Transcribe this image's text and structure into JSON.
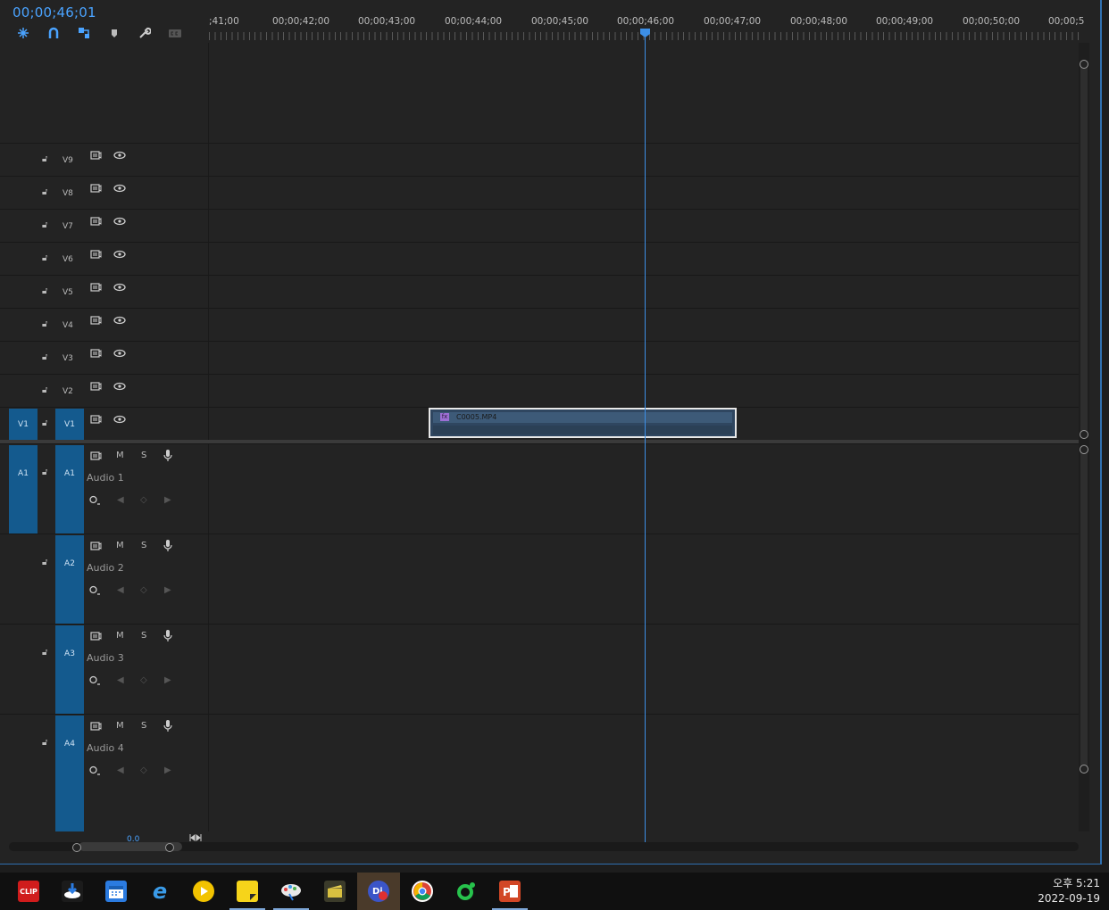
{
  "timeline": {
    "timecode": "00;00;46;01",
    "ruler_labels": [
      ";41;00",
      "00;00;42;00",
      "00;00;43;00",
      "00;00;44;00",
      "00;00;45;00",
      "00;00;46;00",
      "00;00;47;00",
      "00;00;48;00",
      "00;00;49;00",
      "00;00;50;00",
      "00;00;5"
    ],
    "video_tracks": [
      {
        "name": "V9"
      },
      {
        "name": "V8"
      },
      {
        "name": "V7"
      },
      {
        "name": "V6"
      },
      {
        "name": "V5"
      },
      {
        "name": "V4"
      },
      {
        "name": "V3"
      },
      {
        "name": "V2"
      },
      {
        "name": "V1"
      }
    ],
    "source_v": "V1",
    "source_a": "A1",
    "audio_tracks": [
      {
        "id": "A1",
        "label": "Audio 1"
      },
      {
        "id": "A2",
        "label": "Audio 2"
      },
      {
        "id": "A3",
        "label": "Audio 3"
      },
      {
        "id": "A4",
        "label": "Audio 4"
      }
    ],
    "mute_label": "M",
    "solo_label": "S",
    "volume_readout": "0.0",
    "clip": {
      "name": "C0005.MP4",
      "fx": "fx"
    }
  },
  "taskbar": {
    "apps": [
      "clip-app-icon",
      "download-app-icon",
      "calendar-app-icon",
      "internet-explorer-icon",
      "media-player-icon",
      "sticky-notes-icon",
      "paint-app-icon",
      "clapper-app-icon",
      "premiere-app-icon",
      "chrome-icon",
      "green-app-icon",
      "powerpoint-icon"
    ],
    "clip_label": "CLIP",
    "time": "오후 5:21",
    "date": "2022-09-19"
  },
  "colors": {
    "accent": "#3d8fe6",
    "target": "#145a8e"
  }
}
